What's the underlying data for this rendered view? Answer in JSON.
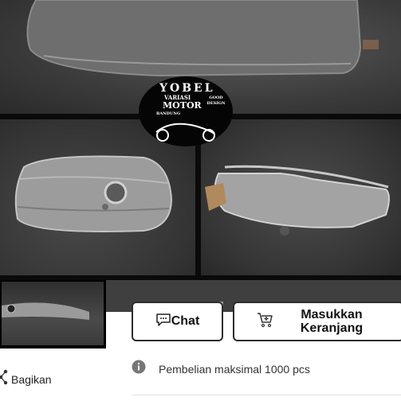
{
  "product_image": {
    "logo": {
      "brand": "YOBEL",
      "line1": "VARIASI",
      "line2": "MOTOR",
      "city": "BANDUNG",
      "badge": "GOOD DESIGN"
    }
  },
  "actions": {
    "chat_label": "Chat",
    "chat_icon": "chat-bubble-icon",
    "cart_label_line1": "Masukkan",
    "cart_label_line2": "Keranjang",
    "cart_icon": "cart-add-icon"
  },
  "share": {
    "label": "Bagikan",
    "icon": "share-icon"
  },
  "purchase_info": {
    "icon": "info-icon",
    "text": "Pembelian maksimal 1000 pcs"
  }
}
